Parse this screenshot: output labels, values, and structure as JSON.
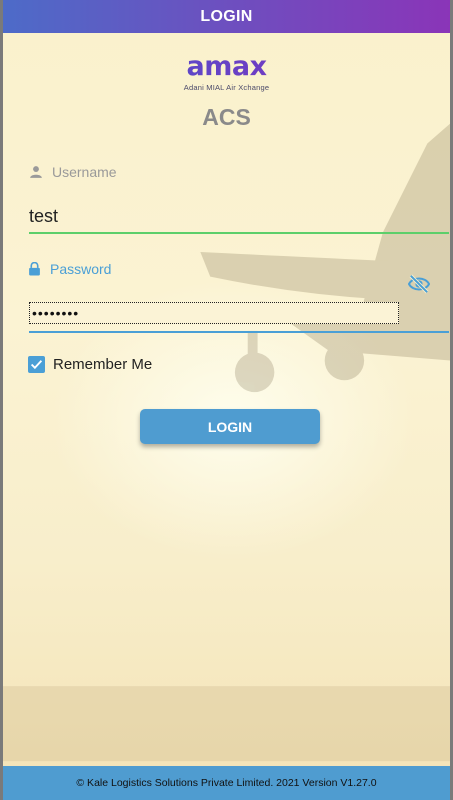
{
  "header": {
    "title": "LOGIN"
  },
  "logo": {
    "brand": "amax",
    "tagline": "Adani MIAL Air Xchange"
  },
  "app_title": "ACS",
  "form": {
    "username_label": "Username",
    "username_value": "test",
    "password_label": "Password",
    "password_value": "testtest",
    "remember_label": "Remember Me",
    "remember_checked": true,
    "login_button": "LOGIN"
  },
  "footer": {
    "text": "© Kale Logistics Solutions Private Limited. 2021 Version V1.27.0"
  },
  "colors": {
    "header_gradient_start": "#4d6bc8",
    "header_gradient_end": "#8a35b8",
    "accent_blue": "#4f9cd0",
    "username_underline": "#5ccf6a",
    "background": "#fbf2cf"
  },
  "icons": {
    "username": "person-icon",
    "password": "lock-icon",
    "toggle_visibility": "eye-off-icon",
    "remember": "checkmark-icon"
  }
}
